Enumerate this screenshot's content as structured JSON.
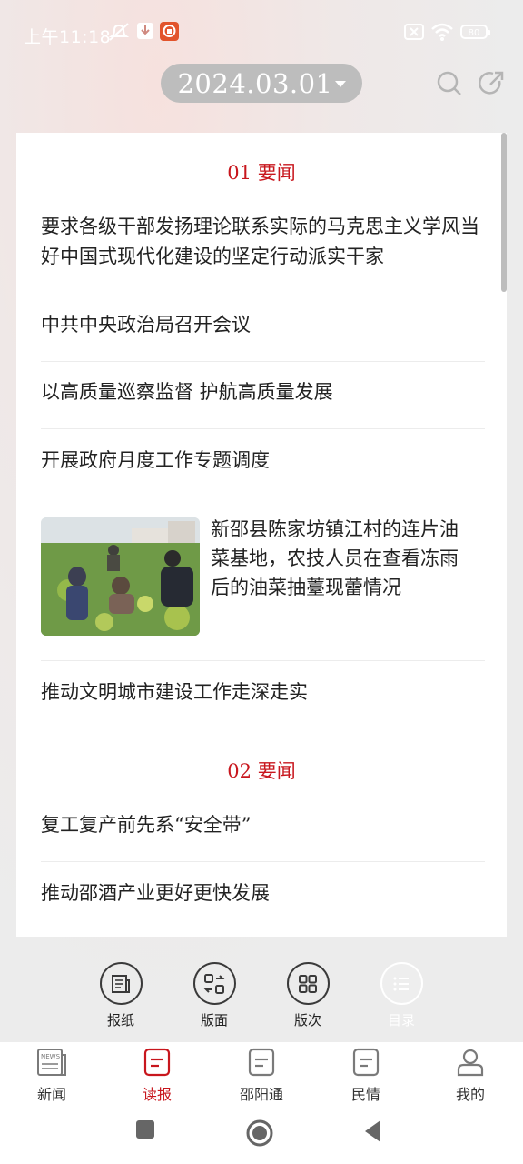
{
  "status_bar": {
    "time": "上午11:18",
    "battery": "80"
  },
  "header": {
    "date": "2024.03.01"
  },
  "sections": [
    {
      "title": "01  要闻"
    },
    {
      "title": "02  要闻"
    }
  ],
  "articles": [
    {
      "title": "要求各级干部发扬理论联系实际的马克思主义学风当好中国式现代化建设的坚定行动派实干家"
    },
    {
      "title": "中共中央政治局召开会议"
    },
    {
      "title": "以高质量巡察监督  护航高质量发展"
    },
    {
      "title": "开展政府月度工作专题调度"
    },
    {
      "title": "新邵县陈家坊镇江村的连片油菜基地，农技人员在查看冻雨后的油菜抽薹现蕾情况"
    },
    {
      "title": "推动文明城市建设工作走深走实"
    },
    {
      "title": "复工复产前先系“安全带”"
    },
    {
      "title": "推动邵酒产业更好更快发展"
    }
  ],
  "tools": [
    {
      "label": "报纸",
      "icon": "newspaper-icon"
    },
    {
      "label": "版面",
      "icon": "layout-switch-icon"
    },
    {
      "label": "版次",
      "icon": "grid-icon"
    },
    {
      "label": "目录",
      "icon": "list-icon"
    }
  ],
  "nav": [
    {
      "label": "新闻",
      "icon": "news-icon"
    },
    {
      "label": "读报",
      "icon": "read-paper-icon"
    },
    {
      "label": "邵阳通",
      "icon": "shaoyang-icon"
    },
    {
      "label": "民情",
      "icon": "public-opinion-icon"
    },
    {
      "label": "我的",
      "icon": "profile-icon"
    }
  ],
  "colors": {
    "accent": "#c8161d",
    "pill": "#bdbdbd"
  }
}
